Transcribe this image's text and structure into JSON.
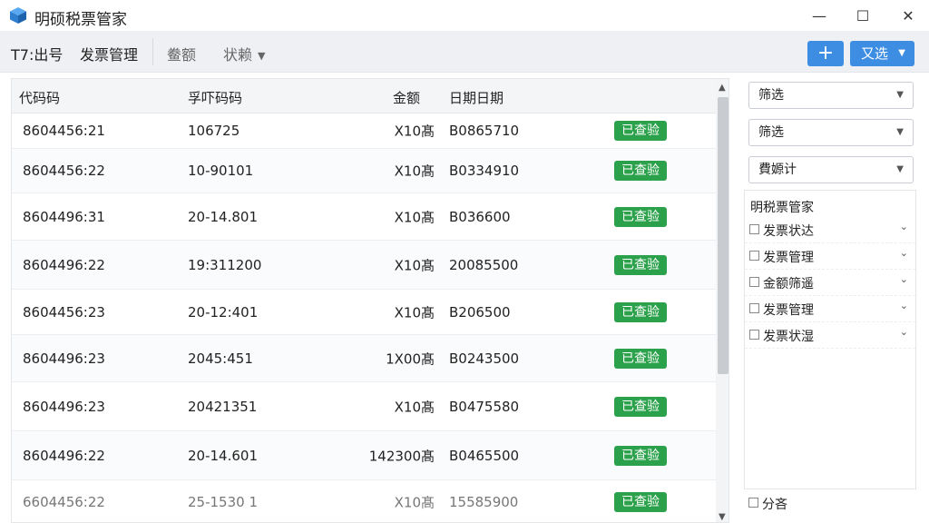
{
  "window": {
    "title": "明硕税票管家",
    "minimize": "—",
    "maximize": "☐",
    "close": "✕"
  },
  "toolbar": {
    "item1": "T7:出号",
    "item2": "发票管理",
    "item3": "鲞额",
    "item4": "状赖",
    "add_label": "+",
    "select_label": "又选"
  },
  "table": {
    "headers": [
      "代码码",
      "孚吓码码",
      "金额",
      "日期日期"
    ],
    "rows": [
      {
        "code": "8604456:21",
        "number": "106725",
        "amount": "X10髙",
        "date": "B0865710",
        "status": "已查验"
      },
      {
        "code": "8604456:22",
        "number": "10-90101",
        "amount": "X10髙",
        "date": "B0334910",
        "status": "已查验"
      },
      {
        "code": "8604496:31",
        "number": "20-14.801",
        "amount": "X10髙",
        "date": "B036600",
        "status": "已查验"
      },
      {
        "code": "8604496:22",
        "number": "19:311200",
        "amount": "X10髙",
        "date": "20085500",
        "status": "已查验"
      },
      {
        "code": "8604456:23",
        "number": "20-12:401",
        "amount": "X10髙",
        "date": "B206500",
        "status": "已查验"
      },
      {
        "code": "8604496:23",
        "number": "2045:451",
        "amount": "1X00髙",
        "date": "B0243500",
        "status": "已查验"
      },
      {
        "code": "8604496:23",
        "number": "20421351",
        "amount": "X10髙",
        "date": "B0475580",
        "status": "已查验"
      },
      {
        "code": "8604496:22",
        "number": "20-14.601",
        "amount": "142300髙",
        "date": "B0465500",
        "status": "已查验"
      },
      {
        "code": "6604456:22",
        "number": "25-1530 1",
        "amount": "X10髙",
        "date": "15585900",
        "status": "已查验"
      }
    ]
  },
  "sidebar": {
    "dropdown1": "筛选",
    "dropdown2": "筛选",
    "dropdown3": "費嫄计",
    "panel_title": "明税票管家",
    "filters": [
      "发票状达",
      "发票管理",
      "金额筛遥",
      "发票管理",
      "发票状湿"
    ],
    "bottom_label": "分吝"
  },
  "colors": {
    "accent": "#3d8ee3",
    "success": "#2aa14a"
  }
}
